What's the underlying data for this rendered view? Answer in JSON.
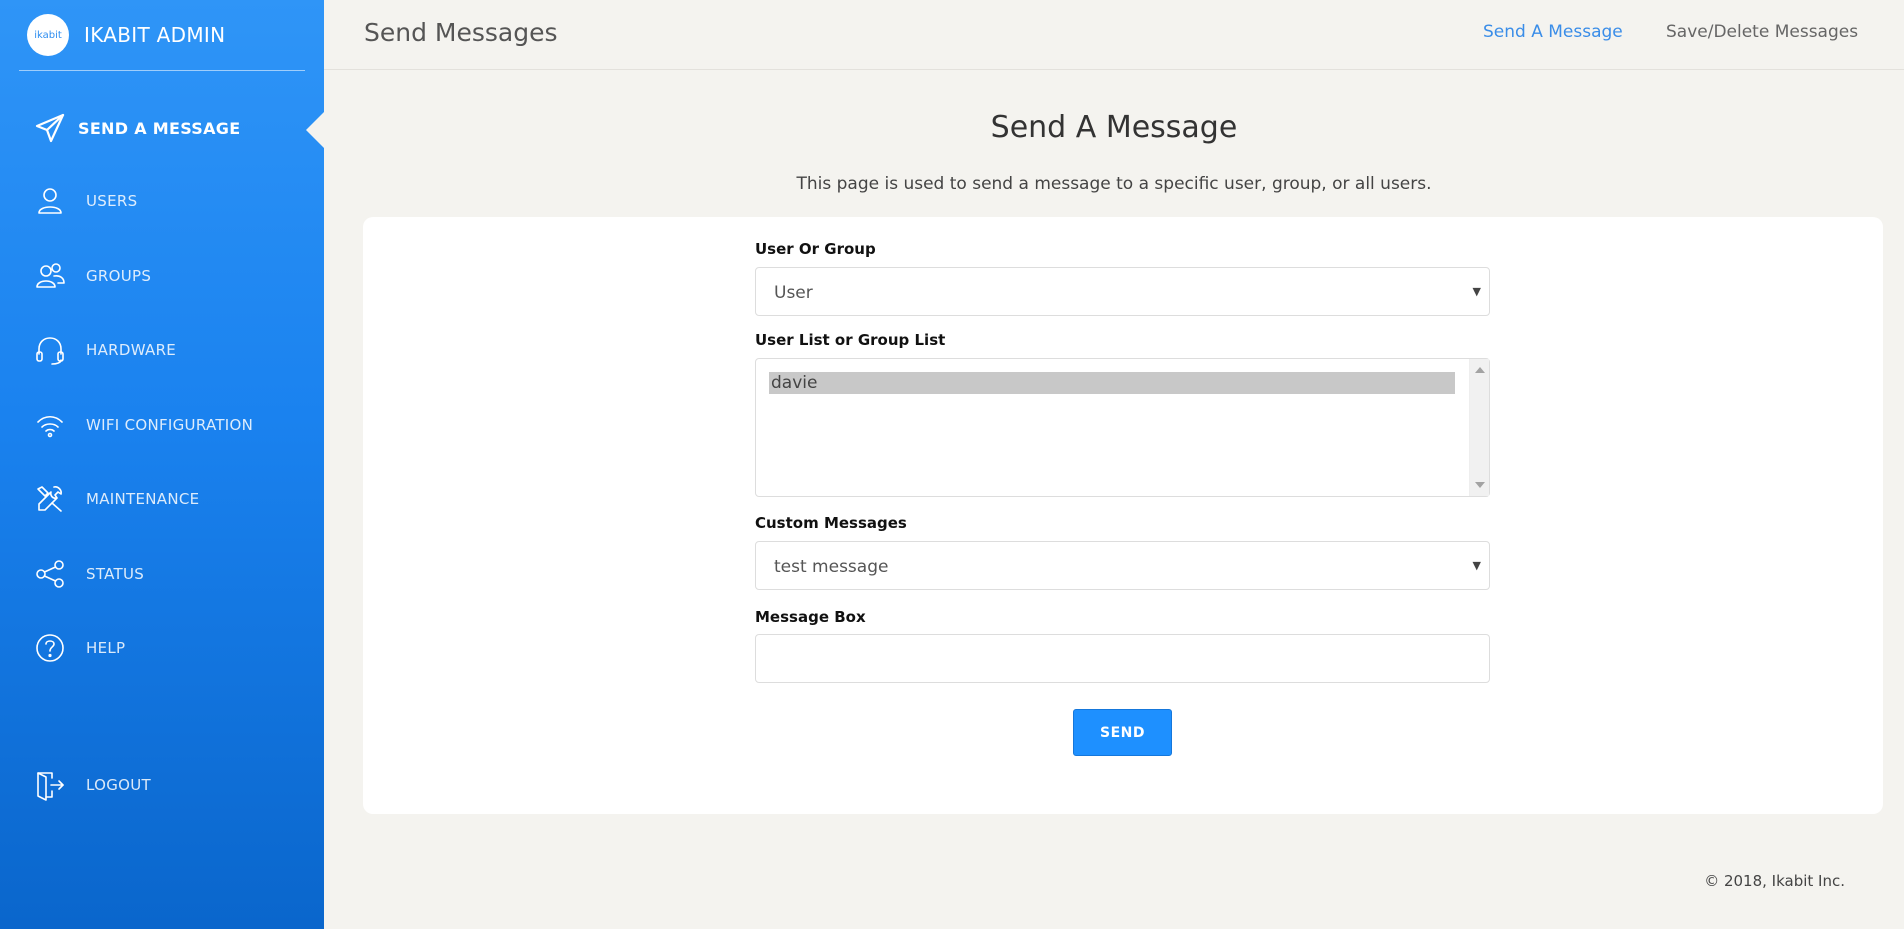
{
  "app": {
    "brand_name": "IKABIT ADMIN",
    "logo_text": "ikabit"
  },
  "sidebar": {
    "items": [
      {
        "label": "SEND A MESSAGE",
        "icon": "paper-plane-icon",
        "active": true
      },
      {
        "label": "USERS",
        "icon": "user-icon"
      },
      {
        "label": "GROUPS",
        "icon": "users-icon"
      },
      {
        "label": "HARDWARE",
        "icon": "headset-icon"
      },
      {
        "label": "WIFI CONFIGURATION",
        "icon": "wifi-icon"
      },
      {
        "label": "MAINTENANCE",
        "icon": "tools-icon"
      },
      {
        "label": "STATUS",
        "icon": "share-nodes-icon"
      },
      {
        "label": "HELP",
        "icon": "question-circle-icon"
      },
      {
        "label": "LOGOUT",
        "icon": "logout-door-icon"
      }
    ]
  },
  "topbar": {
    "title": "Send Messages",
    "links": [
      {
        "label": "Send A Message",
        "active": true
      },
      {
        "label": "Save/Delete Messages"
      }
    ]
  },
  "main": {
    "heading": "Send A Message",
    "description": "This page is used to send a message to a specific user, group, or all users.",
    "form": {
      "user_or_group": {
        "label": "User Or Group",
        "value": "User"
      },
      "user_list": {
        "label": "User List or Group List",
        "options": [
          "davie"
        ],
        "selected": "davie"
      },
      "custom_messages": {
        "label": "Custom Messages",
        "value": "test message"
      },
      "message_box": {
        "label": "Message Box",
        "value": ""
      },
      "send_label": "SEND"
    }
  },
  "footer": {
    "text": "© 2018, Ikabit Inc."
  },
  "colors": {
    "accent": "#1e90ff",
    "sidebar_top": "#2f95f7",
    "sidebar_bottom": "#0a66cc",
    "page_bg": "#f4f3ef"
  }
}
